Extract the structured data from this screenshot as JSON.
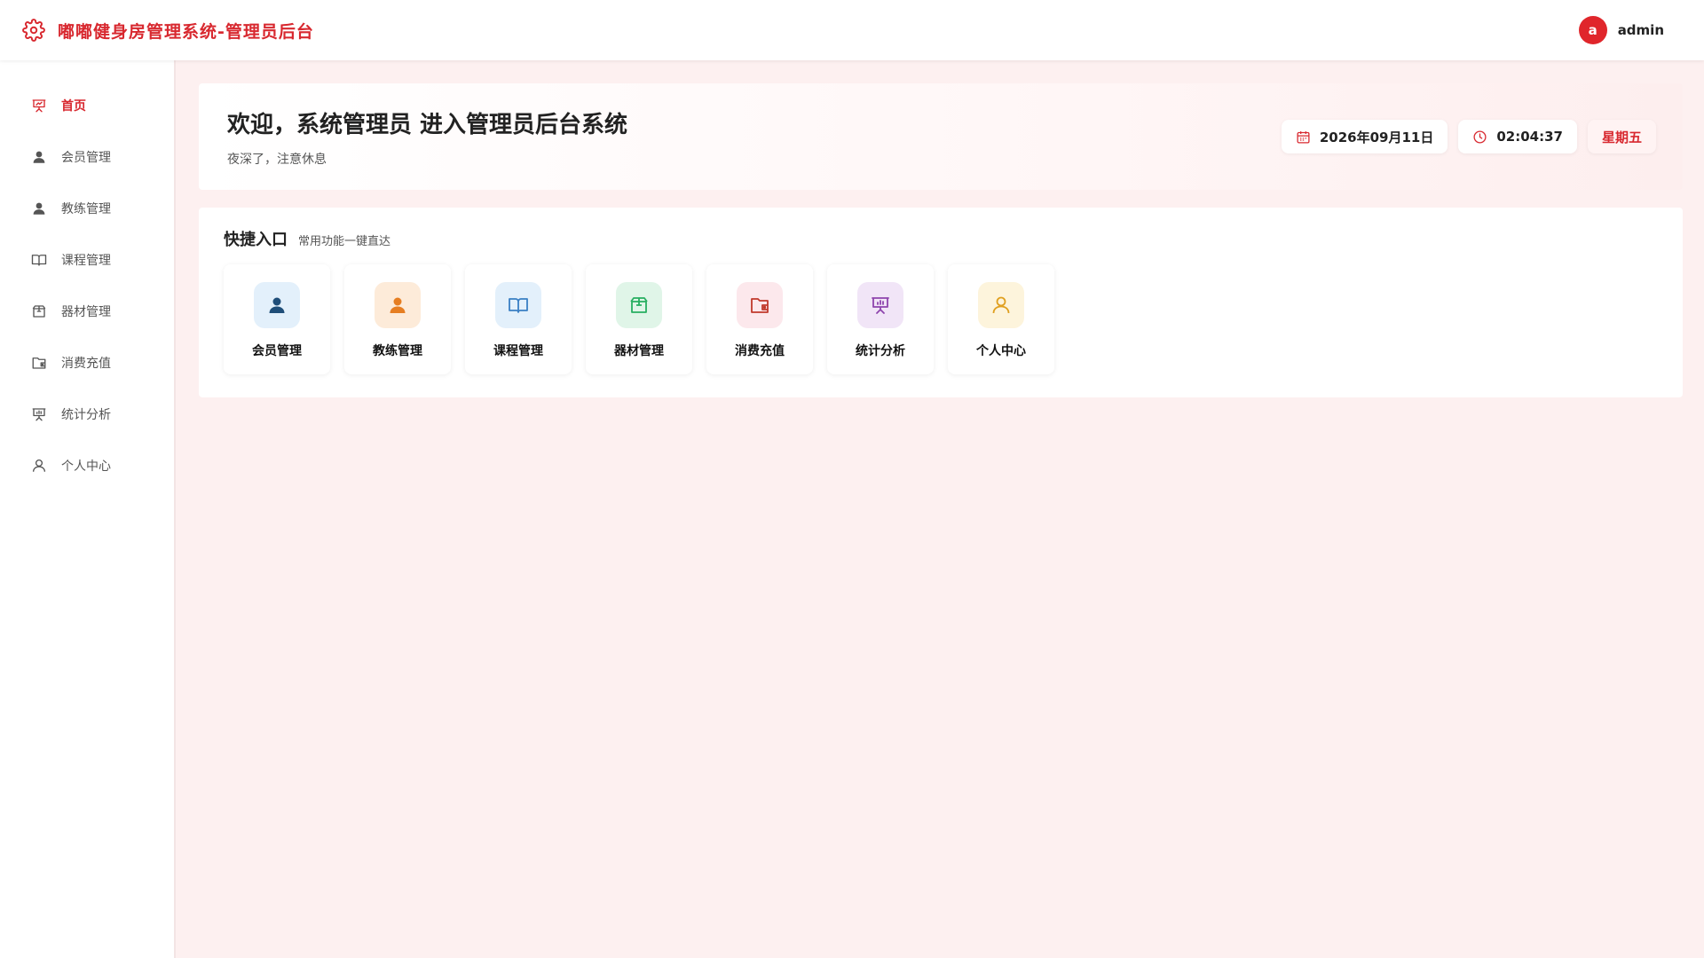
{
  "header": {
    "title": "嘟嘟健身房管理系统-管理员后台",
    "logo_icon": "gear-icon",
    "avatar_letter": "a",
    "username": "admin"
  },
  "sidebar": {
    "items": [
      {
        "label": "首页",
        "icon": "presentation-chart-icon",
        "active": true
      },
      {
        "label": "会员管理",
        "icon": "user-filled-icon"
      },
      {
        "label": "教练管理",
        "icon": "user-filled-icon"
      },
      {
        "label": "课程管理",
        "icon": "book-icon"
      },
      {
        "label": "器材管理",
        "icon": "box-icon"
      },
      {
        "label": "消费充值",
        "icon": "wallet-icon"
      },
      {
        "label": "统计分析",
        "icon": "presentation-chart-icon"
      },
      {
        "label": "个人中心",
        "icon": "user-outline-icon"
      }
    ]
  },
  "welcome": {
    "title": "欢迎，系统管理员 进入管理员后台系统",
    "subtitle": "夜深了，注意休息",
    "date": "2026年09月11日",
    "time": "02:04:37",
    "weekday": "星期五"
  },
  "quick": {
    "title": "快捷入口",
    "subtitle": "常用功能一键直达",
    "cards": [
      {
        "label": "会员管理",
        "icon": "user-filled-icon",
        "color": "#1f4e79",
        "bg": "#e3f0fb"
      },
      {
        "label": "教练管理",
        "icon": "user-filled-icon",
        "color": "#e67e22",
        "bg": "#fdebd9"
      },
      {
        "label": "课程管理",
        "icon": "book-icon",
        "color": "#3a7fc4",
        "bg": "#e3f0fb"
      },
      {
        "label": "器材管理",
        "icon": "box-icon",
        "color": "#27ae60",
        "bg": "#e0f5e8"
      },
      {
        "label": "消费充值",
        "icon": "wallet-icon",
        "color": "#c0392b",
        "bg": "#fce8ec"
      },
      {
        "label": "统计分析",
        "icon": "presentation-chart-icon",
        "color": "#8e44ad",
        "bg": "#f1e5f7"
      },
      {
        "label": "个人中心",
        "icon": "user-outline-icon",
        "color": "#e0a020",
        "bg": "#fdf4dc"
      }
    ]
  },
  "colors": {
    "brand": "#d8282f"
  }
}
